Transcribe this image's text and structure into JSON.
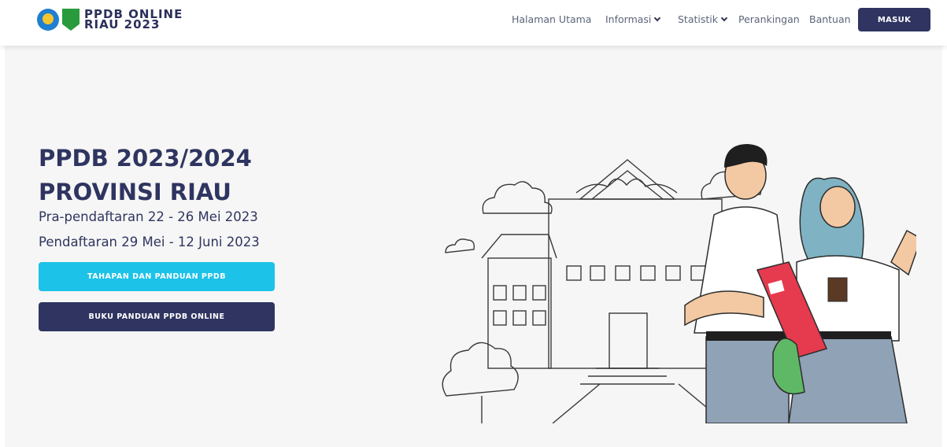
{
  "brand": {
    "line1": "PPDB ONLINE",
    "line2": "RIAU 2023"
  },
  "nav": {
    "items": [
      {
        "label": "Halaman Utama",
        "dropdown": false
      },
      {
        "label": "Informasi",
        "dropdown": true
      },
      {
        "label": "Statistik",
        "dropdown": true
      },
      {
        "label": "Perankingan",
        "dropdown": false
      },
      {
        "label": "Bantuan",
        "dropdown": false
      }
    ],
    "login_label": "MASUK"
  },
  "hero": {
    "title_line1": "PPDB 2023/2024",
    "title_line2": "PROVINSI RIAU",
    "prereg": "Pra-pendaftaran 22 - 26 Mei 2023",
    "reg": "Pendaftaran 29 Mei - 12 Juni 2023",
    "btn_guide": "TAHAPAN DAN PANDUAN PPDB",
    "btn_book": "BUKU PANDUAN PPDB ONLINE"
  },
  "colors": {
    "navy": "#2f3560",
    "cyan": "#1dc2e8",
    "background": "#f6f6f6"
  }
}
